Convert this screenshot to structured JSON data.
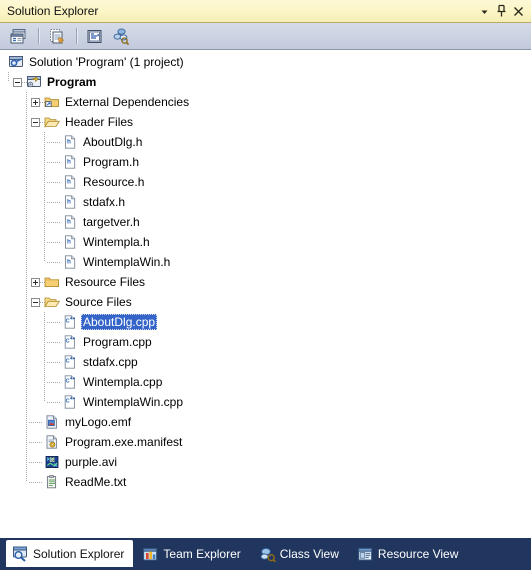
{
  "window": {
    "title": "Solution Explorer",
    "controls": [
      {
        "name": "dropdown-icon",
        "label": "Window position menu"
      },
      {
        "name": "pin-icon",
        "label": "Auto Hide"
      },
      {
        "name": "close-icon",
        "label": "Close"
      }
    ]
  },
  "toolbar": {
    "buttons": [
      {
        "name": "properties-window-button",
        "icon": "properties-icon",
        "label": "Properties Window"
      },
      {
        "name": "show-all-files-button",
        "icon": "show-all-files-icon",
        "label": "Show All Files"
      },
      {
        "name": "view-code-button",
        "icon": "view-code-icon",
        "label": "View Code"
      },
      {
        "name": "view-class-diagram-button",
        "icon": "class-diagram-icon",
        "label": "View Class Diagram"
      }
    ]
  },
  "tree": {
    "items": [
      {
        "label": "Solution 'Program' (1 project)",
        "icon": "solution-icon",
        "depth": 0,
        "expander": "none",
        "bold": false,
        "selected": false
      },
      {
        "label": "Program",
        "icon": "project-icon",
        "depth": 1,
        "expander": "minus",
        "bold": true,
        "selected": false
      },
      {
        "label": "External Dependencies",
        "icon": "folder-dependencies-icon",
        "depth": 2,
        "expander": "plus",
        "bold": false,
        "selected": false
      },
      {
        "label": "Header Files",
        "icon": "folder-open-icon",
        "depth": 2,
        "expander": "minus",
        "bold": false,
        "selected": false
      },
      {
        "label": "AboutDlg.h",
        "icon": "header-file-icon",
        "depth": 3,
        "expander": "none",
        "bold": false,
        "selected": false
      },
      {
        "label": "Program.h",
        "icon": "header-file-icon",
        "depth": 3,
        "expander": "none",
        "bold": false,
        "selected": false
      },
      {
        "label": "Resource.h",
        "icon": "header-file-icon",
        "depth": 3,
        "expander": "none",
        "bold": false,
        "selected": false
      },
      {
        "label": "stdafx.h",
        "icon": "header-file-icon",
        "depth": 3,
        "expander": "none",
        "bold": false,
        "selected": false
      },
      {
        "label": "targetver.h",
        "icon": "header-file-icon",
        "depth": 3,
        "expander": "none",
        "bold": false,
        "selected": false
      },
      {
        "label": "Wintempla.h",
        "icon": "header-file-icon",
        "depth": 3,
        "expander": "none",
        "bold": false,
        "selected": false
      },
      {
        "label": "WintemplaWin.h",
        "icon": "header-file-icon",
        "depth": 3,
        "expander": "none",
        "bold": false,
        "selected": false
      },
      {
        "label": "Resource Files",
        "icon": "folder-closed-icon",
        "depth": 2,
        "expander": "plus",
        "bold": false,
        "selected": false
      },
      {
        "label": "Source Files",
        "icon": "folder-open-icon",
        "depth": 2,
        "expander": "minus",
        "bold": false,
        "selected": false
      },
      {
        "label": "AboutDlg.cpp",
        "icon": "cpp-file-icon",
        "depth": 3,
        "expander": "none",
        "bold": false,
        "selected": true
      },
      {
        "label": "Program.cpp",
        "icon": "cpp-file-icon",
        "depth": 3,
        "expander": "none",
        "bold": false,
        "selected": false
      },
      {
        "label": "stdafx.cpp",
        "icon": "cpp-file-icon",
        "depth": 3,
        "expander": "none",
        "bold": false,
        "selected": false
      },
      {
        "label": "Wintempla.cpp",
        "icon": "cpp-file-icon",
        "depth": 3,
        "expander": "none",
        "bold": false,
        "selected": false
      },
      {
        "label": "WintemplaWin.cpp",
        "icon": "cpp-file-icon",
        "depth": 3,
        "expander": "none",
        "bold": false,
        "selected": false
      },
      {
        "label": "myLogo.emf",
        "icon": "emf-file-icon",
        "depth": 2,
        "expander": "none",
        "bold": false,
        "selected": false
      },
      {
        "label": "Program.exe.manifest",
        "icon": "manifest-file-icon",
        "depth": 2,
        "expander": "none",
        "bold": false,
        "selected": false
      },
      {
        "label": "purple.avi",
        "icon": "avi-file-icon",
        "depth": 2,
        "expander": "none",
        "bold": false,
        "selected": false
      },
      {
        "label": "ReadMe.txt",
        "icon": "txt-file-icon",
        "depth": 2,
        "expander": "none",
        "bold": false,
        "selected": false
      }
    ]
  },
  "tabs": [
    {
      "label": "Solution Explorer",
      "icon": "solution-explorer-icon",
      "active": true
    },
    {
      "label": "Team Explorer",
      "icon": "team-explorer-icon",
      "active": false
    },
    {
      "label": "Class View",
      "icon": "class-view-icon",
      "active": false
    },
    {
      "label": "Resource View",
      "icon": "resource-view-icon",
      "active": false
    }
  ],
  "colors": {
    "titlebar": "#fbf4c4",
    "toolbar": "#ccd3e2",
    "tree_background": "#ffffff",
    "selection": "#3464c8",
    "tabbar": "#21365e",
    "folder": "#f5c462"
  }
}
